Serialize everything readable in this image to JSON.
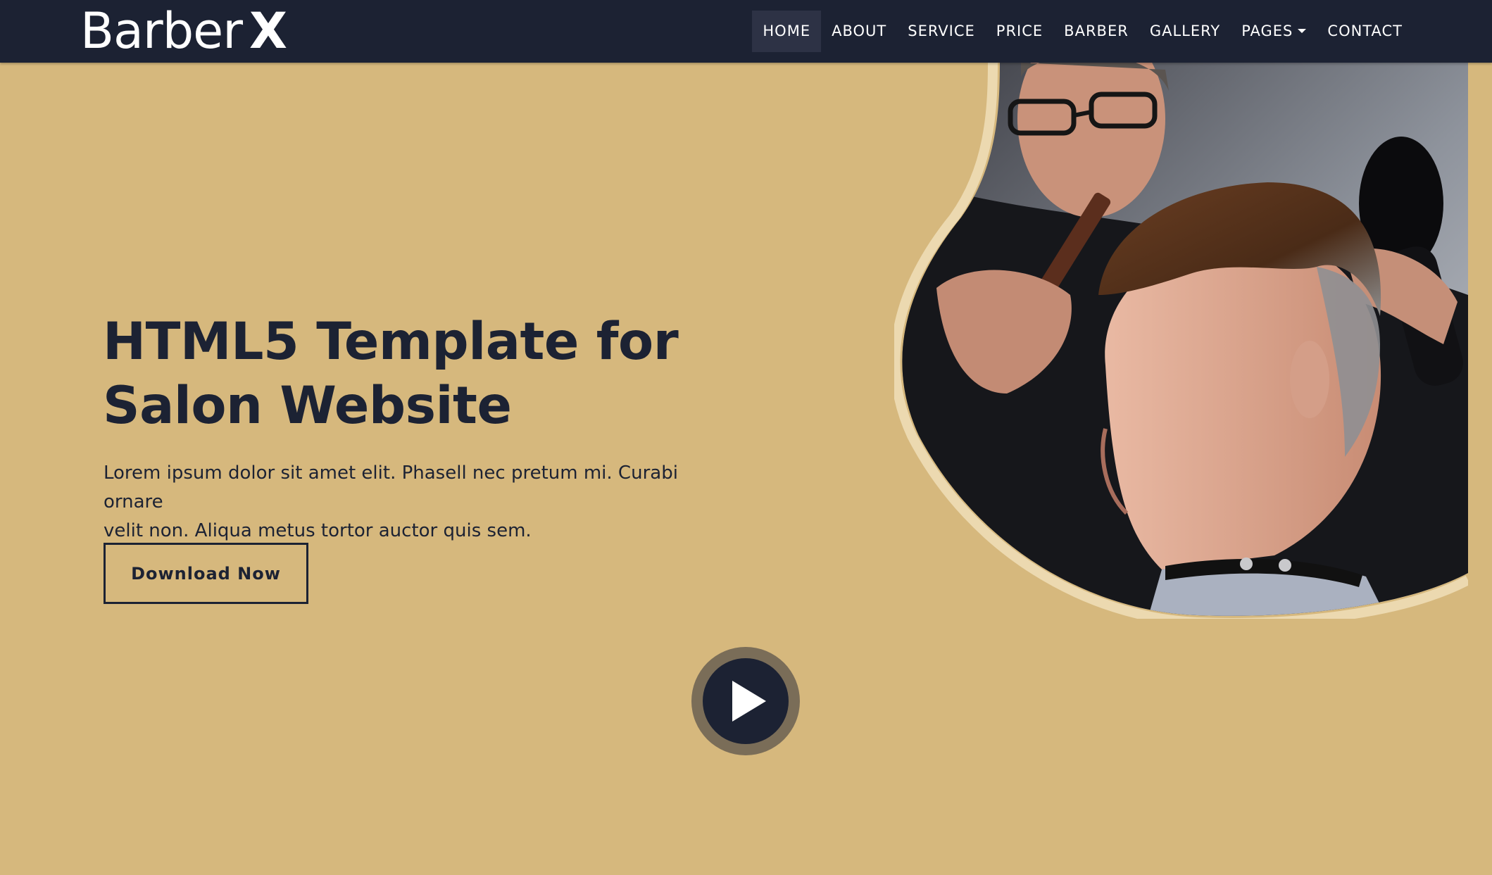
{
  "brand": {
    "name": "Barber",
    "mark": "X"
  },
  "nav": {
    "items": [
      {
        "label": "HOME",
        "active": true
      },
      {
        "label": "ABOUT"
      },
      {
        "label": "SERVICE"
      },
      {
        "label": "PRICE"
      },
      {
        "label": "BARBER"
      },
      {
        "label": "GALLERY"
      },
      {
        "label": "PAGES",
        "dropdown": true
      },
      {
        "label": "CONTACT"
      }
    ]
  },
  "hero": {
    "title_line1": "HTML5 Template for",
    "title_line2": "Salon Website",
    "text_line1": "Lorem ipsum dolor sit amet elit. Phasell nec pretum mi. Curabi ornare",
    "text_line2": "velit non. Aliqua metus tortor auctor quis sem.",
    "cta_label": "Download Now"
  },
  "colors": {
    "background": "#d6b87d",
    "navbar": "#1c2233",
    "nav_active": "#2d3245",
    "text_dark": "#1c2233",
    "blob_outline": "#ecd9b0",
    "play_ring": "#7a6d58"
  },
  "icons": {
    "play": "play-icon",
    "dropdown": "caret-down-icon"
  }
}
